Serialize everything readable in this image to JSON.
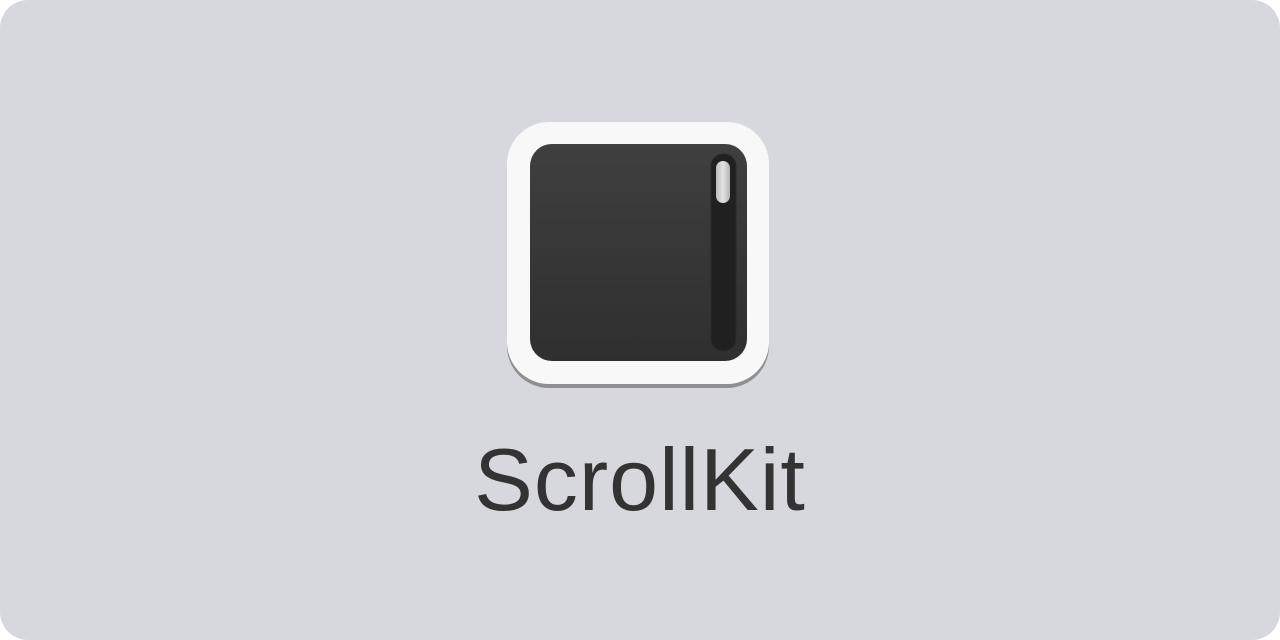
{
  "app": {
    "name": "ScrollKit"
  },
  "logo": {
    "icon": "scrollbar-window-icon"
  },
  "colors": {
    "background": "#d7d8dd",
    "text": "#333333",
    "icon_frame": "#f8f8f8",
    "icon_frame_shadow": "#8f8f93",
    "icon_screen": "#363636",
    "scroll_track": "#202020",
    "scroll_thumb": "#c9c9c9"
  }
}
